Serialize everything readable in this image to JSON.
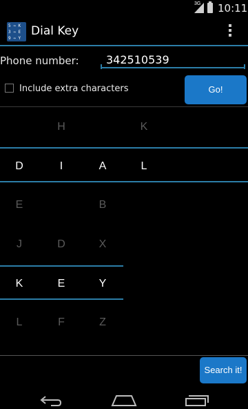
{
  "status_bar": {
    "network": "3G",
    "time": "10:11"
  },
  "app": {
    "title": "Dial Key",
    "icon": "dialkey-app-icon",
    "icon_text": "5 ⇒ K\n3 ⇒ E\n9 ⇒ Y"
  },
  "form": {
    "phone_label": "Phone number:",
    "phone_value": "342510539",
    "include_extra_label": "Include extra characters",
    "include_extra_checked": false,
    "go_label": "Go!"
  },
  "grid": {
    "rows": [
      {
        "kind": "option",
        "letters": [
          "",
          "H",
          "",
          "K"
        ]
      },
      {
        "kind": "selected",
        "letters": [
          "D",
          "I",
          "A",
          "L"
        ]
      },
      {
        "kind": "option",
        "letters": [
          "E",
          "",
          "B",
          ""
        ]
      },
      {
        "kind": "option",
        "letters": [
          "J",
          "D",
          "X",
          ""
        ]
      },
      {
        "kind": "selected",
        "letters": [
          "K",
          "E",
          "Y",
          ""
        ]
      },
      {
        "kind": "option",
        "letters": [
          "L",
          "F",
          "Z",
          ""
        ]
      }
    ]
  },
  "search": {
    "label": "Search it!"
  },
  "colors": {
    "accent_line": "#2c7ea8",
    "button_bg": "#1b78c8",
    "dim_letter": "#5a5a5a"
  },
  "nav_icons": [
    "back-icon",
    "home-icon",
    "recents-icon"
  ]
}
